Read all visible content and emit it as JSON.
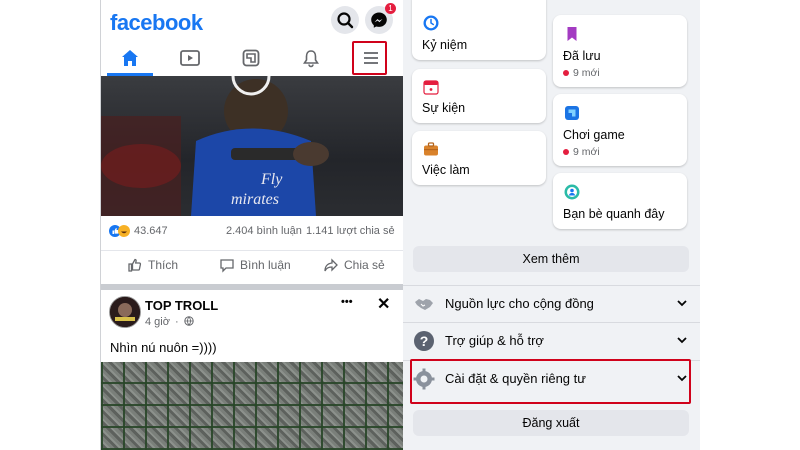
{
  "left": {
    "logo": "facebook",
    "messenger_badge": "1",
    "tabs": [
      "home",
      "watch",
      "gaming",
      "notifications",
      "menu"
    ],
    "video_overlay_text": "Fly\nEmirates",
    "stats": {
      "reactions": "43.647",
      "comments": "2.404 bình luận",
      "shares": "1.141 lượt chia sẻ"
    },
    "actions": {
      "like": "Thích",
      "comment": "Bình luận",
      "share": "Chia sẻ"
    },
    "post": {
      "author": "TOP TROLL",
      "time": "4 giờ",
      "more": "•••",
      "close": "✕",
      "text": "Nhìn nú nuôn =))))"
    }
  },
  "right": {
    "shortcuts_left": [
      {
        "label": "Kỷ niệm"
      },
      {
        "label": "Sự kiện"
      },
      {
        "label": "Việc làm"
      }
    ],
    "shortcuts_right": [
      {
        "label": "Đã lưu",
        "sub": "9 mới"
      },
      {
        "label": "Chơi game",
        "sub": "9 mới"
      },
      {
        "label": "Bạn bè quanh đây"
      }
    ],
    "see_more": "Xem thêm",
    "sections": [
      {
        "label": "Nguồn lực cho cộng đồng"
      },
      {
        "label": "Trợ giúp & hỗ trợ"
      },
      {
        "label": "Cài đặt & quyền riêng tư"
      }
    ],
    "logout": "Đăng xuất"
  },
  "colors": {
    "brand": "#1877f2",
    "highlight": "#d0021b",
    "notification": "#e41e3f",
    "menu_bg": "#f0f2f5"
  }
}
